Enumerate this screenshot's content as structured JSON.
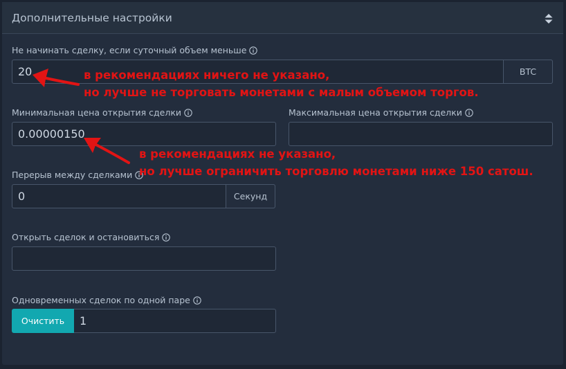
{
  "panel": {
    "title": "Дополнительные настройки"
  },
  "fields": {
    "min_volume": {
      "label": "Не начинать сделку, если суточный объем меньше",
      "value": "20",
      "addon": "BTC"
    },
    "min_price": {
      "label": "Минимальная цена открытия сделки",
      "value": "0.00000150"
    },
    "max_price": {
      "label": "Максимальная цена открытия сделки",
      "value": ""
    },
    "pause": {
      "label": "Перерыв между сделками",
      "value": "0",
      "addon": "Секунд"
    },
    "open_and_stop": {
      "label": "Открыть сделок и остановиться",
      "value": ""
    },
    "concurrent": {
      "label": "Одновременных сделок по одной паре",
      "button": "Очистить",
      "value": "1"
    }
  },
  "annotations": {
    "note1_line1": "в рекомендациях ничего не указано,",
    "note1_line2": "но лучше не торговать монетами с малым объемом торгов.",
    "note2_line1": "в рекомендациях не указано,",
    "note2_line2": "но лучше ограничить торговлю монетами ниже 150 сатош.",
    "color": "#e21414"
  },
  "colors": {
    "background": "#1b2330",
    "panel": "#232d3d",
    "accent": "#12a8b0"
  }
}
